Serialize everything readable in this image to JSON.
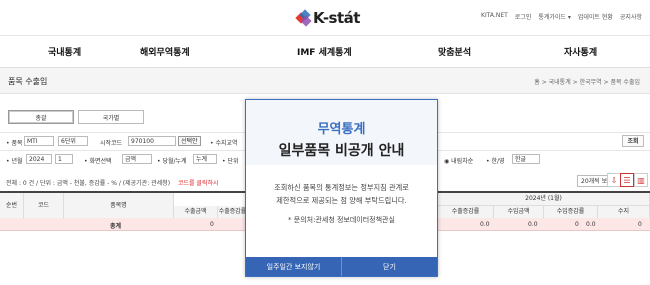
{
  "logo": {
    "text": "K-stát",
    "icon": "kstat-logo-icon",
    "colors": [
      "#e8392b",
      "#2a6ebd",
      "#8f4fb3"
    ]
  },
  "toplinks": [
    "KITA.NET",
    "로그인",
    "통계가이드 ▾",
    "업데이트 현황",
    "공지사항"
  ],
  "gnb": [
    "국내통계",
    "해외무역통계",
    "IMF 세계통계",
    "맞춤분석",
    "자사통계"
  ],
  "page_title": "품목 수출입",
  "breadcrumb": "홈 > 국내통계 > 한국무역 > 품목 수출입",
  "tabs": [
    "총괄",
    "국가별"
  ],
  "filter1": {
    "item_label": "품목",
    "item_value": "MTI",
    "unit_value": "6단위",
    "start_code_label": "시작코드",
    "start_code_value": "970100",
    "select_button": "선택안",
    "suffix": "수지교역",
    "lookup": "조회"
  },
  "filter2": {
    "period_label": "년월",
    "year": "2024",
    "month": "1",
    "screen_label": "화면선택",
    "screen_value": "금액",
    "period2_value": "당월/누계",
    "cumulative": "누계",
    "unit_label": "단위",
    "domestic": "내림차순",
    "lang_label": "한/영",
    "lang_value": "한글"
  },
  "info": {
    "text": "전체 : 0 건 / 단위 : 금액 - 천불, 증감률 - % / (제공기관: 관세청)",
    "red": "코드를 클릭하시",
    "per_page": "20개씩 보기"
  },
  "table": {
    "headers": [
      "순번",
      "코드",
      "품목명",
      "수출금액",
      "수출증감률",
      "2024년 (1월)",
      "수출증감률",
      "수입금액",
      "수입증감률",
      "수지"
    ],
    "total_label": "총계",
    "total_values": [
      "0",
      "0.0",
      "0.0",
      "0",
      "0.0",
      "0"
    ]
  },
  "modal": {
    "title": "무역통계",
    "subtitle": "일부품목 비공개 안내",
    "body_line1": "조회하신 품목의 통계정보는 정부지침 관계로",
    "body_line2": "제한적으로 제공되는 점 양해 부탁드립니다.",
    "note": "* 문의처:관세청 정보데이터정책관실",
    "btn_hide": "일주일간 보지않기",
    "btn_close": "닫기",
    "accent": "#3565b4"
  }
}
